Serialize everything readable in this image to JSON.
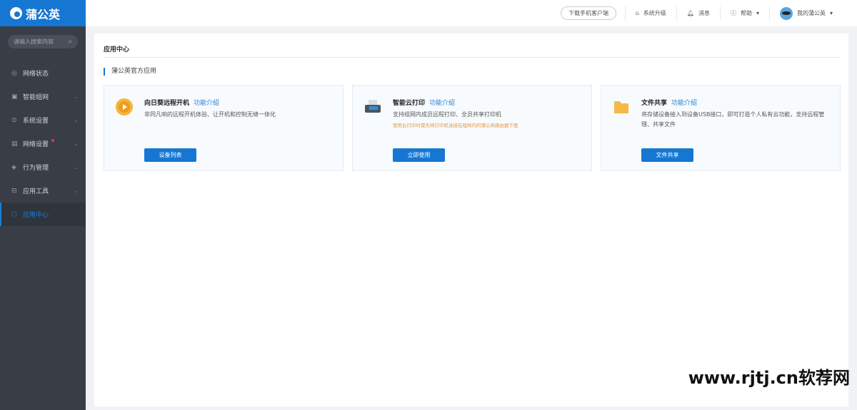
{
  "app": {
    "logo": "蒲公英",
    "brand_color": "#1677d2"
  },
  "sidebar": {
    "search_placeholder": "请输入搜索内容",
    "items": [
      {
        "label": "网络状态",
        "icon": "globe-icon",
        "chevron": false
      },
      {
        "label": "智能组网",
        "icon": "network-icon",
        "chevron": true
      },
      {
        "label": "系统设置",
        "icon": "gear-icon",
        "chevron": true
      },
      {
        "label": "网络设置",
        "icon": "settings-icon",
        "chevron": true,
        "badge_dot": true
      },
      {
        "label": "行为管理",
        "icon": "eye-icon",
        "chevron": true
      },
      {
        "label": "应用工具",
        "icon": "toolbox-icon",
        "chevron": true
      },
      {
        "label": "应用中心",
        "icon": "cube-icon",
        "chevron": false,
        "active": true
      }
    ]
  },
  "topbar": {
    "download": "下载手机客户端",
    "upgrade": "系统升级",
    "messages": "消息",
    "help": "帮助",
    "account": "我的蒲公英"
  },
  "main": {
    "title": "应用中心",
    "section": "蒲公英官方应用",
    "cards": [
      {
        "title": "向日葵远程开机",
        "intro": "功能介绍",
        "desc": "非同凡响的远程开机体验、让开机和控制无缝一体化",
        "warn": "",
        "button": "设备列表"
      },
      {
        "title": "智能云打印",
        "intro": "功能介绍",
        "desc": "支持组网内成员远程打印、全员共享打印机",
        "warn": "使用云打印时需先将打印机连接在组网内的蒲公英路由器下面",
        "button": "立即使用"
      },
      {
        "title": "文件共享",
        "intro": "功能介绍",
        "desc": "将存储设备接入到设备USB接口，即可打造个人私有云功能，支持远程管理、共享文件",
        "warn": "",
        "button": "文件共享"
      }
    ]
  },
  "watermark": "www.rjtj.cn软荐网"
}
